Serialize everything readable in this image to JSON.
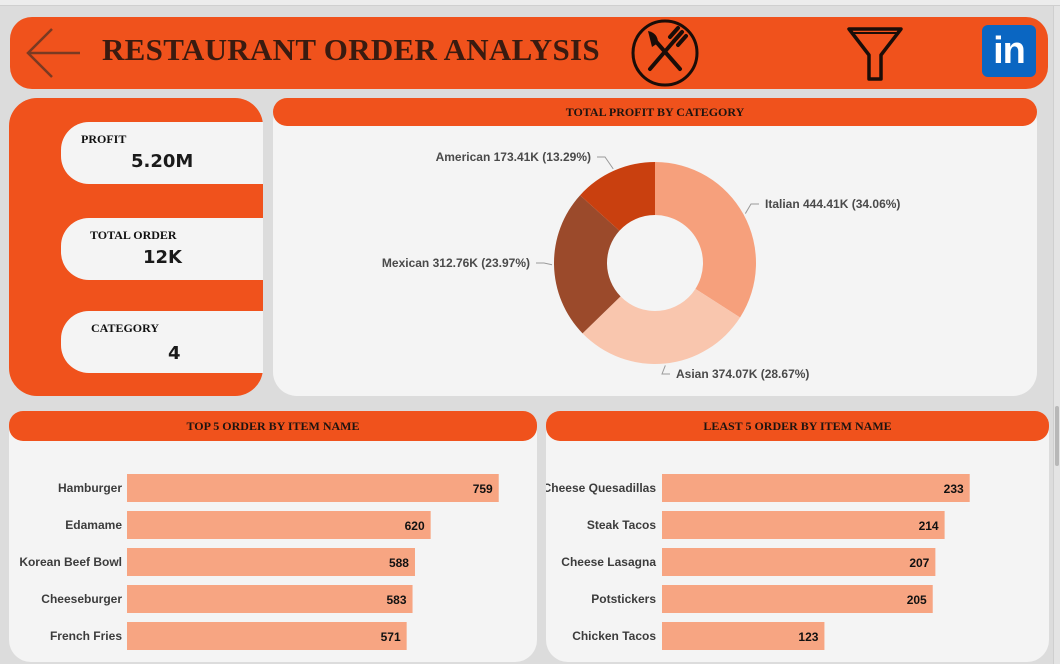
{
  "header": {
    "title": "RESTAURANT ORDER ANALYSIS",
    "icons": [
      "back-arrow-icon",
      "fork-knife-icon",
      "filter-icon",
      "linkedin-icon"
    ],
    "linkedin_text": "in"
  },
  "kpis": [
    {
      "label": "PROFIT",
      "value": "5.20M"
    },
    {
      "label": "TOTAL ORDER",
      "value": "12K"
    },
    {
      "label": "CATEGORY",
      "value": "4"
    }
  ],
  "colors": {
    "brand": "#f0521c",
    "panel": "#f4f4f4",
    "bar": "#f7a582"
  },
  "chart_data": [
    {
      "type": "pie",
      "title": "TOTAL PROFIT BY CATEGORY",
      "categories": [
        "Italian",
        "Asian",
        "Mexican",
        "American"
      ],
      "values": [
        444.41,
        374.07,
        312.76,
        173.41
      ],
      "labels": [
        "Italian 444.41K (34.06%)",
        "Asian 374.07K (28.67%)",
        "Mexican 312.76K (23.97%)",
        "American 173.41K (13.29%)"
      ],
      "colors": [
        "#f6a07c",
        "#f9c6ae",
        "#9b4a2b",
        "#c9400f"
      ],
      "donut": true
    },
    {
      "type": "bar",
      "orientation": "horizontal",
      "title": "TOP 5 ORDER BY ITEM NAME",
      "categories": [
        "Hamburger",
        "Edamame",
        "Korean Beef Bowl",
        "Cheeseburger",
        "French Fries"
      ],
      "values": [
        759,
        620,
        588,
        583,
        571
      ],
      "xlim": [
        0,
        880
      ]
    },
    {
      "type": "bar",
      "orientation": "horizontal",
      "title": "LEAST 5 ORDER BY ITEM NAME",
      "categories": [
        "Cheese Quesadillas",
        "Steak Tacos",
        "Cheese Lasagna",
        "Potstickers",
        "Chicken Tacos"
      ],
      "values": [
        233,
        214,
        207,
        205,
        123
      ],
      "xlim": [
        0,
        262
      ]
    }
  ]
}
